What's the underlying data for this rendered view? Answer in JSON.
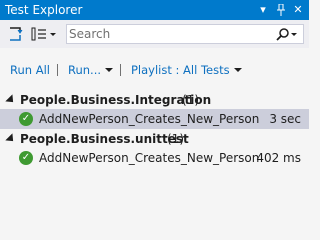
{
  "window": {
    "title": "Test Explorer",
    "controls": [
      "▾",
      "⊣",
      "✕"
    ]
  },
  "toolbar": {
    "search_placeholder": "Search",
    "search_icon": "search-icon"
  },
  "commands": {
    "run_all": "Run All",
    "run": "Run...",
    "playlist": "Playlist : All Tests"
  },
  "groups": [
    {
      "name": "People.Business.Integration",
      "count": "(1)",
      "tests": [
        {
          "name": "AddNewPerson_Creates_New_Person",
          "duration": "3 sec",
          "status": "passed",
          "selected": true
        }
      ]
    },
    {
      "name": "People.Business.unittest",
      "count": "(1)",
      "tests": [
        {
          "name": "AddNewPerson_Creates_New_Person",
          "duration": "402 ms",
          "status": "passed",
          "selected": false
        }
      ]
    }
  ],
  "colors": {
    "accent": "#007acc",
    "pass": "#3f9a32",
    "link": "#0e70c0",
    "selected_row": "#cccedb"
  }
}
